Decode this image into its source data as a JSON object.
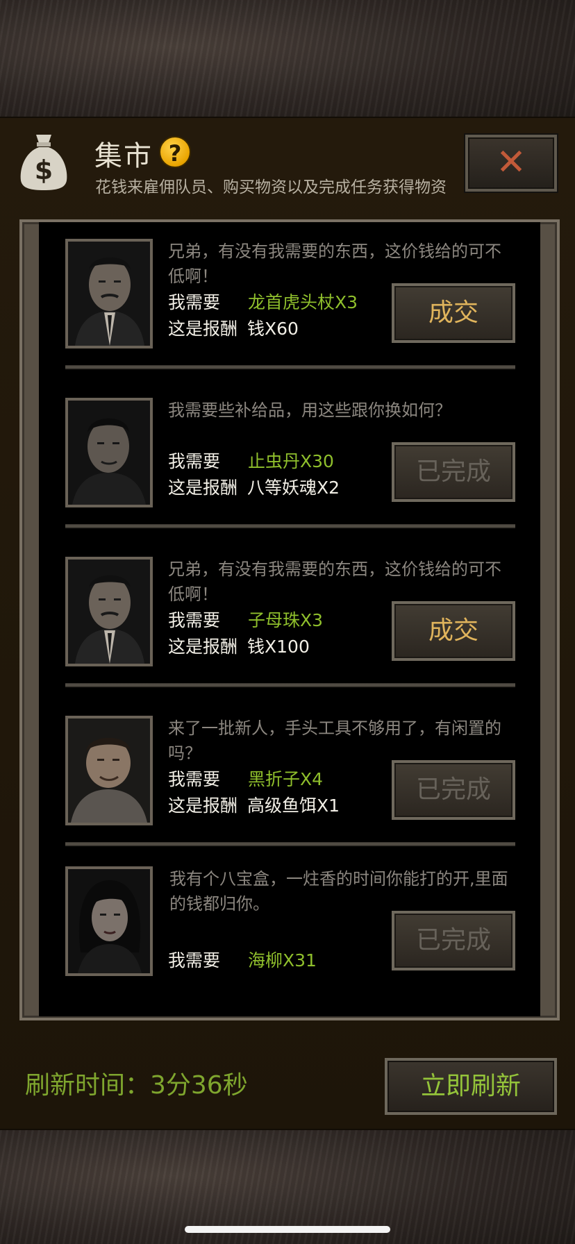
{
  "header": {
    "title": "集市",
    "help_symbol": "?",
    "subtitle": "花钱来雇佣队员、购买物资以及完成任务获得物资",
    "close_symbol": "✕"
  },
  "icons": {
    "money_bag": "money-bag-icon",
    "help": "question-icon",
    "close": "close-icon"
  },
  "quests": [
    {
      "dialog": "兄弟，有没有我需要的东西，这价钱给的可不低啊！",
      "need_label": "我需要",
      "need_value": "龙首虎头杖X3",
      "reward_label": "这是报酬",
      "reward_value": "钱X60",
      "button": "成交",
      "status": "deal"
    },
    {
      "dialog": "我需要些补给品，用这些跟你换如何？",
      "need_label": "我需要",
      "need_value": "止虫丹X30",
      "reward_label": "这是报酬",
      "reward_value": "八等妖魂X2",
      "button": "已完成",
      "status": "done"
    },
    {
      "dialog": "兄弟，有没有我需要的东西，这价钱给的可不低啊！",
      "need_label": "我需要",
      "need_value": "子母珠X3",
      "reward_label": "这是报酬",
      "reward_value": "钱X100",
      "button": "成交",
      "status": "deal"
    },
    {
      "dialog": "来了一批新人，手头工具不够用了，有闲置的吗？",
      "need_label": "我需要",
      "need_value": "黑折子X4",
      "reward_label": "这是报酬",
      "reward_value": "高级鱼饵X1",
      "button": "已完成",
      "status": "done"
    },
    {
      "dialog": "我有个八宝盒，一炷香的时间你能打的开,里面的钱都归你。",
      "need_label": "我需要",
      "need_value": "海柳X31",
      "button": "已完成",
      "status": "done"
    }
  ],
  "footer": {
    "refresh_label": "刷新时间：3分36秒",
    "refresh_button": "立即刷新"
  },
  "colors": {
    "need_value": "#8fbf2c",
    "deal_button": "#e0b45c",
    "done_button": "#67625a",
    "refresh": "#7fa62e"
  }
}
